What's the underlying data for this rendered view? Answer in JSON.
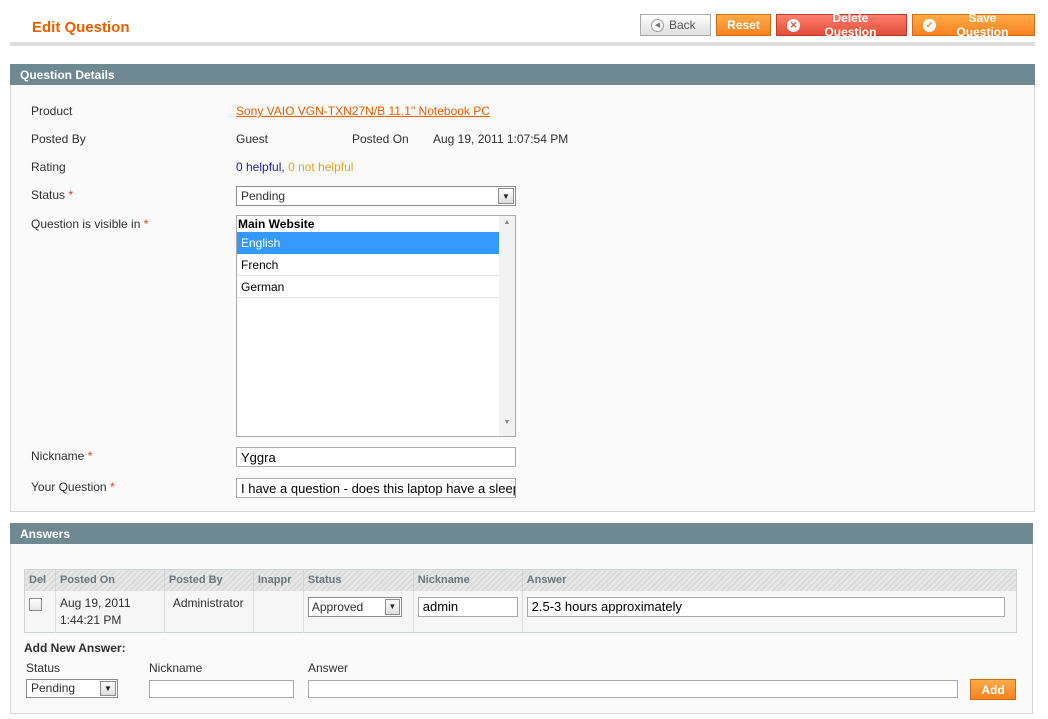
{
  "header": {
    "title": "Edit Question",
    "back_label": "Back",
    "reset_label": "Reset",
    "delete_label": "Delete Question",
    "save_label": "Save Question"
  },
  "details": {
    "section_title": "Question Details",
    "product_label": "Product",
    "product_value": "Sony VAIO VGN-TXN27N/B 11.1\" Notebook PC",
    "posted_by_label": "Posted By",
    "posted_by_value": "Guest",
    "posted_on_label": "Posted On",
    "posted_on_value": "Aug 19, 2011 1:07:54 PM",
    "rating_label": "Rating",
    "rating_helpful": "0 helpful",
    "rating_separator": ",",
    "rating_not_helpful": "0 not helpful",
    "status_label": "Status",
    "status_value": "Pending",
    "visible_label": "Question is visible in",
    "visible_group": "Main Website",
    "visible_options": [
      {
        "label": "English",
        "selected": true
      },
      {
        "label": "French",
        "selected": false
      },
      {
        "label": "German",
        "selected": false
      }
    ],
    "nickname_label": "Nickname",
    "nickname_value": "Yggra",
    "question_label": "Your Question",
    "question_value": "I have a question - does this laptop have a sleeping mode?",
    "required_mark": "*"
  },
  "answers": {
    "section_title": "Answers",
    "columns": [
      "Del",
      "Posted On",
      "Posted By",
      "Inappr",
      "Status",
      "Nickname",
      "Answer"
    ],
    "rows": [
      {
        "posted_on_line1": "Aug 19, 2011",
        "posted_on_line2": "1:44:21 PM",
        "posted_by": "Administrator",
        "status": "Approved",
        "nickname": "admin",
        "answer": "2.5-3 hours approximately"
      }
    ],
    "add_new": {
      "title": "Add New Answer:",
      "status_label": "Status",
      "status_value": "Pending",
      "nickname_label": "Nickname",
      "nickname_value": "",
      "answer_label": "Answer",
      "answer_value": "",
      "add_label": "Add"
    }
  },
  "colors": {
    "accent_orange": "#eb5e00",
    "section_header": "#6f8992",
    "selection_blue": "#3399ff",
    "required_red": "#eb340a"
  }
}
